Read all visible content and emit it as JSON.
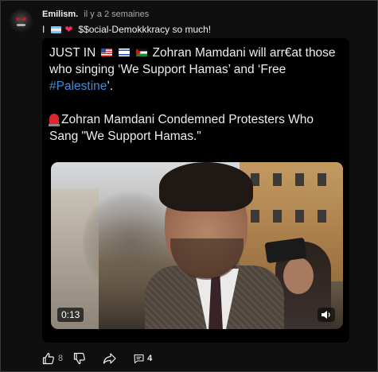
{
  "comment": {
    "author": "Emilism.",
    "time": "il y a 2 semaines",
    "prefix": "I",
    "text": "$$ocial-Demokkkracy so much!",
    "flag_icon": "transgender-flag-icon",
    "heart_icon": "heart-icon"
  },
  "post": {
    "line1_start": "JUST IN",
    "line1_rest": "Zohran Mamdani will arr€at those",
    "line2": "who singing ‘We Support Hamas’ and ‘Free",
    "hashtag": "#Palestine",
    "line3_end": "’.",
    "line4": "Zohran Mamdani Condemned Protesters Who",
    "line5": "Sang \"We Support Hamas.\"",
    "colors": {
      "hashtag": "#3d8bd9"
    }
  },
  "video": {
    "duration": "0:13",
    "volume_icon": "volume-icon"
  },
  "actions": {
    "like_count": "8",
    "reply_count": "4"
  }
}
